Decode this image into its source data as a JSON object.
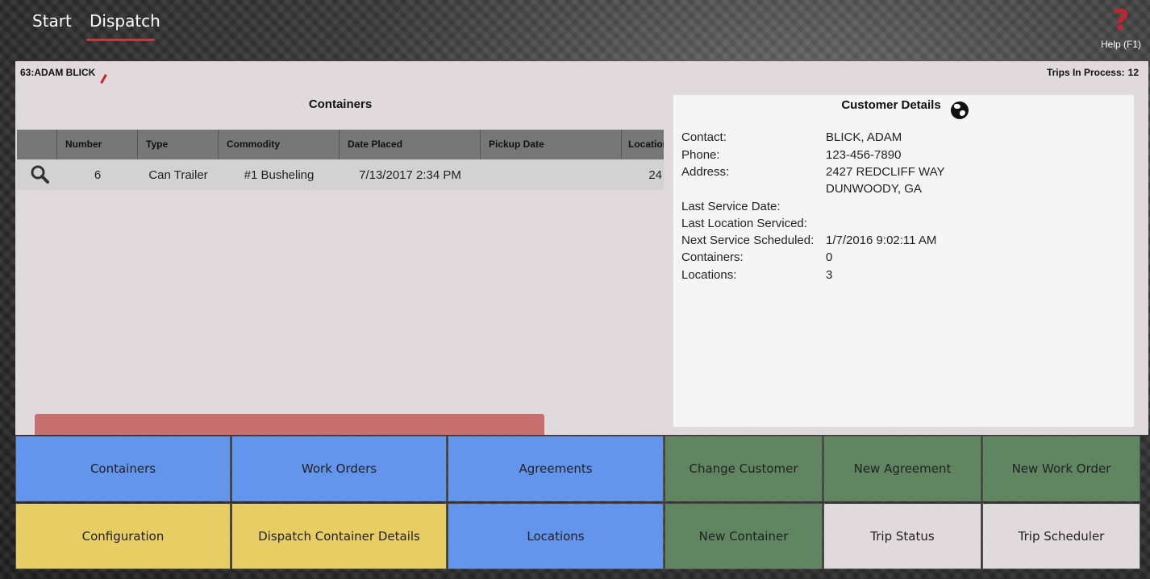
{
  "nav": {
    "start": "Start",
    "dispatch": "Dispatch",
    "help_label": "Help (F1)",
    "help_symbol": "?"
  },
  "customer_header": {
    "name": "63:ADAM BLICK",
    "trips_label": "Trips In Process:",
    "trips_value": "12"
  },
  "containers": {
    "title": "Containers",
    "columns": [
      "",
      "Number",
      "Type",
      "Commodity",
      "Date Placed",
      "Pickup Date",
      "Location"
    ],
    "rows": [
      {
        "number": "6",
        "type": "Can Trailer",
        "commodity": "#1 Busheling",
        "date_placed": "7/13/2017 2:34 PM",
        "pickup_date": "",
        "location": "24"
      }
    ]
  },
  "customer_details": {
    "title": "Customer Details",
    "contact_label": "Contact:",
    "contact": "BLICK, ADAM",
    "phone_label": "Phone:",
    "phone": "123-456-7890",
    "address_label": "Address:",
    "address1": "2427 REDCLIFF WAY",
    "address2": "DUNWOODY, GA",
    "last_service_label": "Last Service Date:",
    "last_service": "",
    "last_location_label": "Last Location Serviced:",
    "last_location": "",
    "next_service_label": "Next Service Scheduled:",
    "next_service": "1/7/2016 9:02:11 AM",
    "containers_label": "Containers:",
    "containers": "0",
    "locations_label": "Locations:",
    "locations": "3"
  },
  "buttons": {
    "containers": "Containers",
    "work_orders": "Work Orders",
    "agreements": "Agreements",
    "change_customer": "Change Customer",
    "new_agreement": "New Agreement",
    "new_work_order": "New Work Order",
    "configuration": "Configuration",
    "dispatch_container_details": "Dispatch Container Details",
    "locations": "Locations",
    "new_container": "New Container",
    "trip_status": "Trip Status",
    "trip_scheduler": "Trip Scheduler"
  },
  "colors": {
    "blue": "#6495ed",
    "green": "#5f8660",
    "yellow": "#e8cd64",
    "gray": "#e0dadc",
    "accent_red": "#c0262f"
  },
  "icons": {
    "help": "help-question-icon",
    "edit": "edit-pencil-icon",
    "search": "search-icon",
    "globe": "globe-icon"
  }
}
